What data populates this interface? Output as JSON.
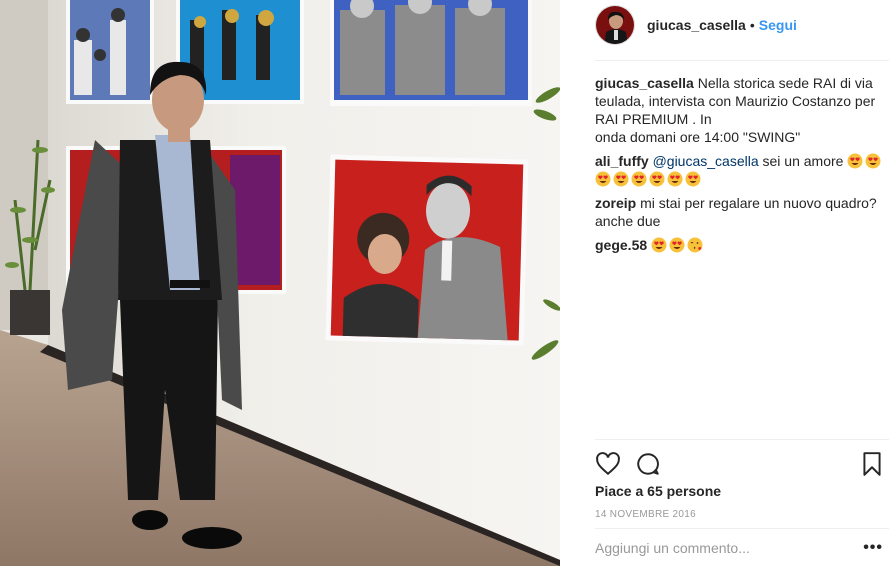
{
  "post": {
    "image_alt": "Foto post",
    "author": "giucas_casella",
    "separator": "•",
    "follow_label": "Segui"
  },
  "caption": {
    "user": "giucas_casella",
    "text_line1": "Nella storica sede RAI di via teulada, intervista con Maurizio Costanzo per RAI PREMIUM . In",
    "text_line2": "onda domani ore 14:00 \"SWING\""
  },
  "comments": [
    {
      "user": "ali_fuffy",
      "mention": "@giucas_casella",
      "text": " sei un amore",
      "emojis": [
        "heart-eyes",
        "heart-eyes",
        "heart-eyes",
        "heart-eyes",
        "heart-eyes",
        "heart-eyes",
        "heart-eyes",
        "heart-eyes"
      ]
    },
    {
      "user": "zoreip",
      "text": "mi stai per regalare un nuovo quadro? anche due",
      "emojis": []
    },
    {
      "user": "gege.58",
      "text": "",
      "emojis": [
        "heart-eyes",
        "heart-eyes",
        "kissing-heart"
      ]
    }
  ],
  "likes_text": "Piace a 65 persone",
  "date_text": "14 NOVEMBRE 2016",
  "add_comment_placeholder": "Aggiungi un commento...",
  "more_label": "•••",
  "icons": {
    "like": "heart-outline-icon",
    "comment": "comment-bubble-icon",
    "save": "bookmark-icon",
    "more": "more-options-icon"
  },
  "colors": {
    "link": "#3897f0",
    "text": "#262626",
    "muted": "#999999",
    "divider": "#efefef"
  }
}
